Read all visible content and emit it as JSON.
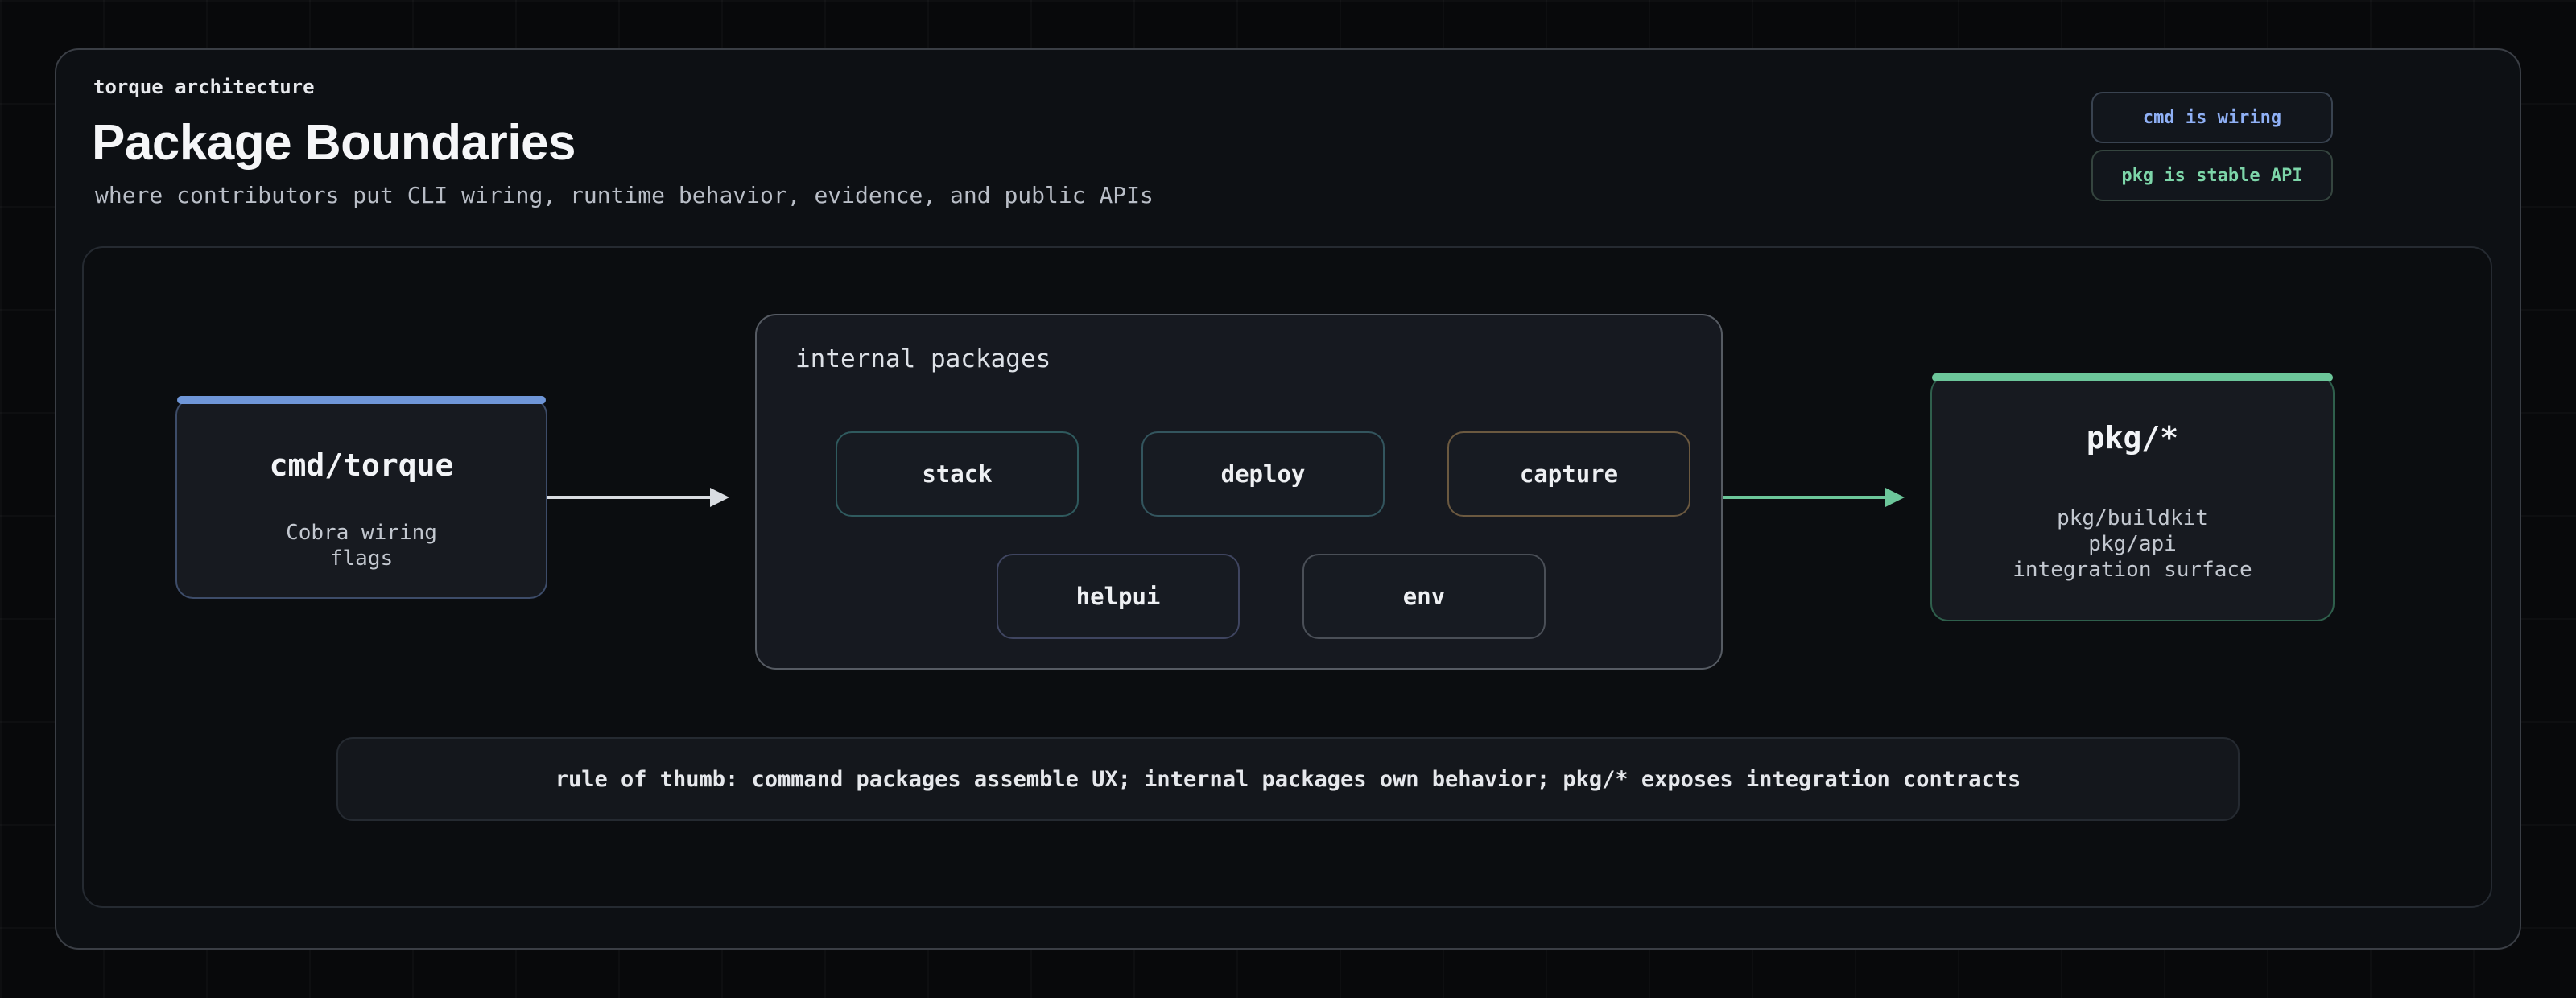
{
  "header": {
    "eyebrow": "torque architecture",
    "title": "Package Boundaries",
    "subtitle": "where contributors put CLI wiring, runtime behavior, evidence, and public APIs"
  },
  "badges": {
    "cmd": "cmd is wiring",
    "pkg": "pkg is stable API"
  },
  "nodes": {
    "cmd": {
      "title": "cmd/torque",
      "lines": [
        "Cobra wiring",
        "flags"
      ]
    },
    "internal": {
      "label": "internal packages",
      "packages": [
        "stack",
        "deploy",
        "capture",
        "helpui",
        "env"
      ]
    },
    "pkg": {
      "title": "pkg/*",
      "lines": [
        "pkg/buildkit",
        "pkg/api",
        "integration surface"
      ]
    }
  },
  "rule": "rule of thumb: command packages assemble UX; internal packages own behavior; pkg/* exposes integration contracts",
  "colors": {
    "cmd_accent": "#6f96d8",
    "pkg_accent": "#6cc69a",
    "arrow_neutral": "#d9dce1"
  }
}
